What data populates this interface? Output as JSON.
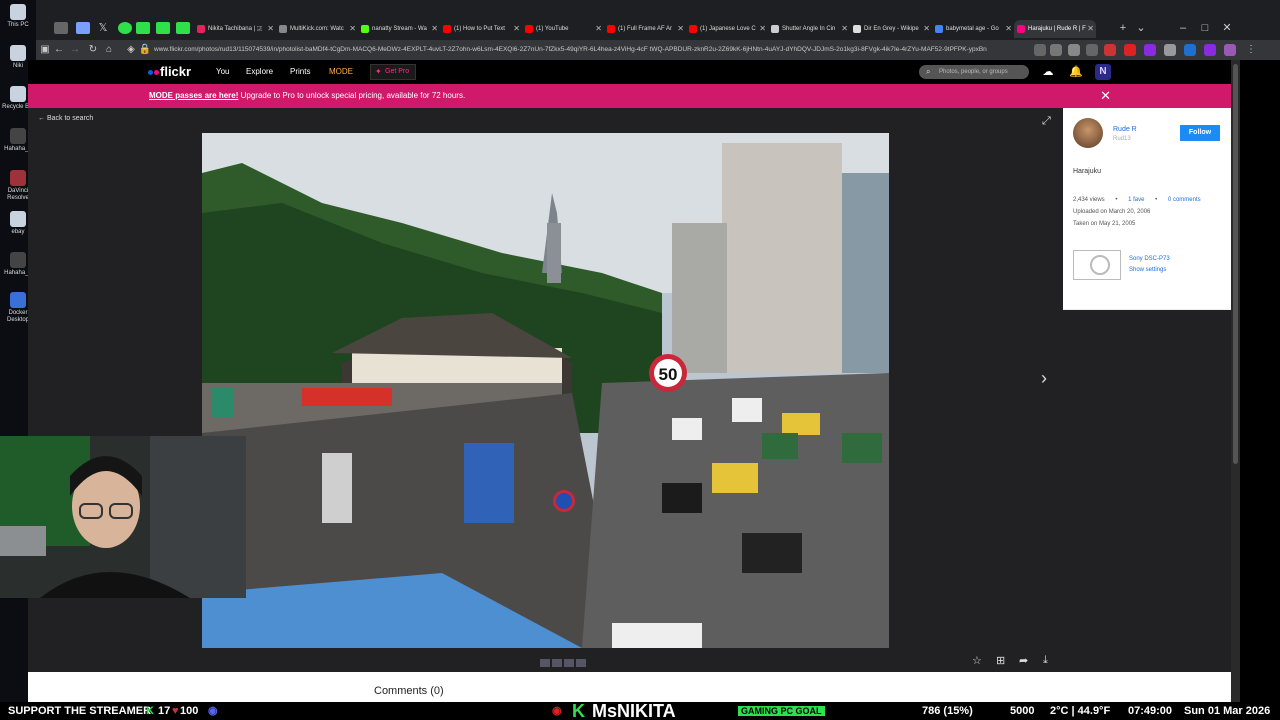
{
  "desktop": {
    "icons": [
      {
        "label": "This PC",
        "icon": "computer-icon"
      },
      {
        "label": "Niki",
        "icon": "folder-icon"
      },
      {
        "label": "Recycle Bin",
        "icon": "recycle-bin-icon"
      },
      {
        "label": "Hahaha_1",
        "icon": "file-icon"
      },
      {
        "label": "DaVinci Resolve",
        "icon": "davinci-icon"
      },
      {
        "label": "ebay",
        "icon": "file-icon"
      },
      {
        "label": "Hahaha_2",
        "icon": "file-icon"
      },
      {
        "label": "Docker Desktop",
        "icon": "docker-icon"
      }
    ]
  },
  "browser": {
    "tabs": [
      {
        "title": "Nikita Tachibana | 🇯",
        "color": "#e0245e"
      },
      {
        "title": "MultiKick.com: Watc",
        "color": "#888888"
      },
      {
        "title": "nanatty Stream - Wa",
        "color": "#53fc18"
      },
      {
        "title": "(1) How to Put Text",
        "color": "#ff0000"
      },
      {
        "title": "(1) YouTube",
        "color": "#ff0000"
      },
      {
        "title": "(1) Full Frame AF Ar",
        "color": "#ff0000"
      },
      {
        "title": "(1) Japanese Love C",
        "color": "#ff0000"
      },
      {
        "title": "Shutter Angle In Cin",
        "color": "#cccccc"
      },
      {
        "title": "Dir En Grey - Wikipe",
        "color": "#dddddd"
      },
      {
        "title": "babymetal age - Go",
        "color": "#4285f4"
      },
      {
        "title": "Harajuku | Rude R | F",
        "color": "#ff0084"
      }
    ],
    "url": "www.flickr.com/photos/rud13/115074539/in/photolist-baMDf4-tCgDm-MACQ6-MeDWz-4EXPLT-4uvLT-2Z7ohn-w6Lsm-4EXQi6-2Z7nUn-7fZkx5-49qiYR-6L4hea-z4ViHg-4cF tWQ-APBDUR-zknR2u-2Z69kK-6jHNtn-4uAYJ-dYhDQV-JDJmS-2o1kg3i-8FVgk-4ik7Ie-4rZYu-MAF52-9tPFPK-ypxBn"
  },
  "flickr": {
    "logo": "flickr",
    "nav": {
      "you": "You",
      "explore": "Explore",
      "prints": "Prints",
      "mode": "MODE",
      "get_pro": "Get Pro"
    },
    "search_placeholder": "Photos, people, or groups",
    "user_initial": "N",
    "banner": {
      "link": "MODE passes are here!",
      "text": " Upgrade to Pro to unlock special pricing, available for 72 hours."
    },
    "back": "Back to search",
    "sign_number": "50",
    "owner": {
      "name": "Rude R",
      "handle": "Rud13",
      "follow": "Follow"
    },
    "photo_title": "Harajuku",
    "stats": {
      "views": "2,434 views",
      "faves": "1 fave",
      "comments": "0 comments"
    },
    "uploaded": "Uploaded on March 20, 2006",
    "taken": "Taken on May 21, 2005",
    "camera": {
      "name": "Sony DSC-P73",
      "settings": "Show settings"
    },
    "comments_label": "Comments (0)"
  },
  "stream_bar": {
    "support": "SUPPORT THE STREAMER",
    "kick_count": "17",
    "hundred": "100",
    "name": "MsNIKITA",
    "goal_label": "GAMING PC GOAL",
    "goal_progress": "786 (15%)",
    "goal_target": "5000",
    "weather": "2°C | 44.9°F",
    "time": "07:49:00",
    "date": "Sun 01 Mar 2026"
  }
}
